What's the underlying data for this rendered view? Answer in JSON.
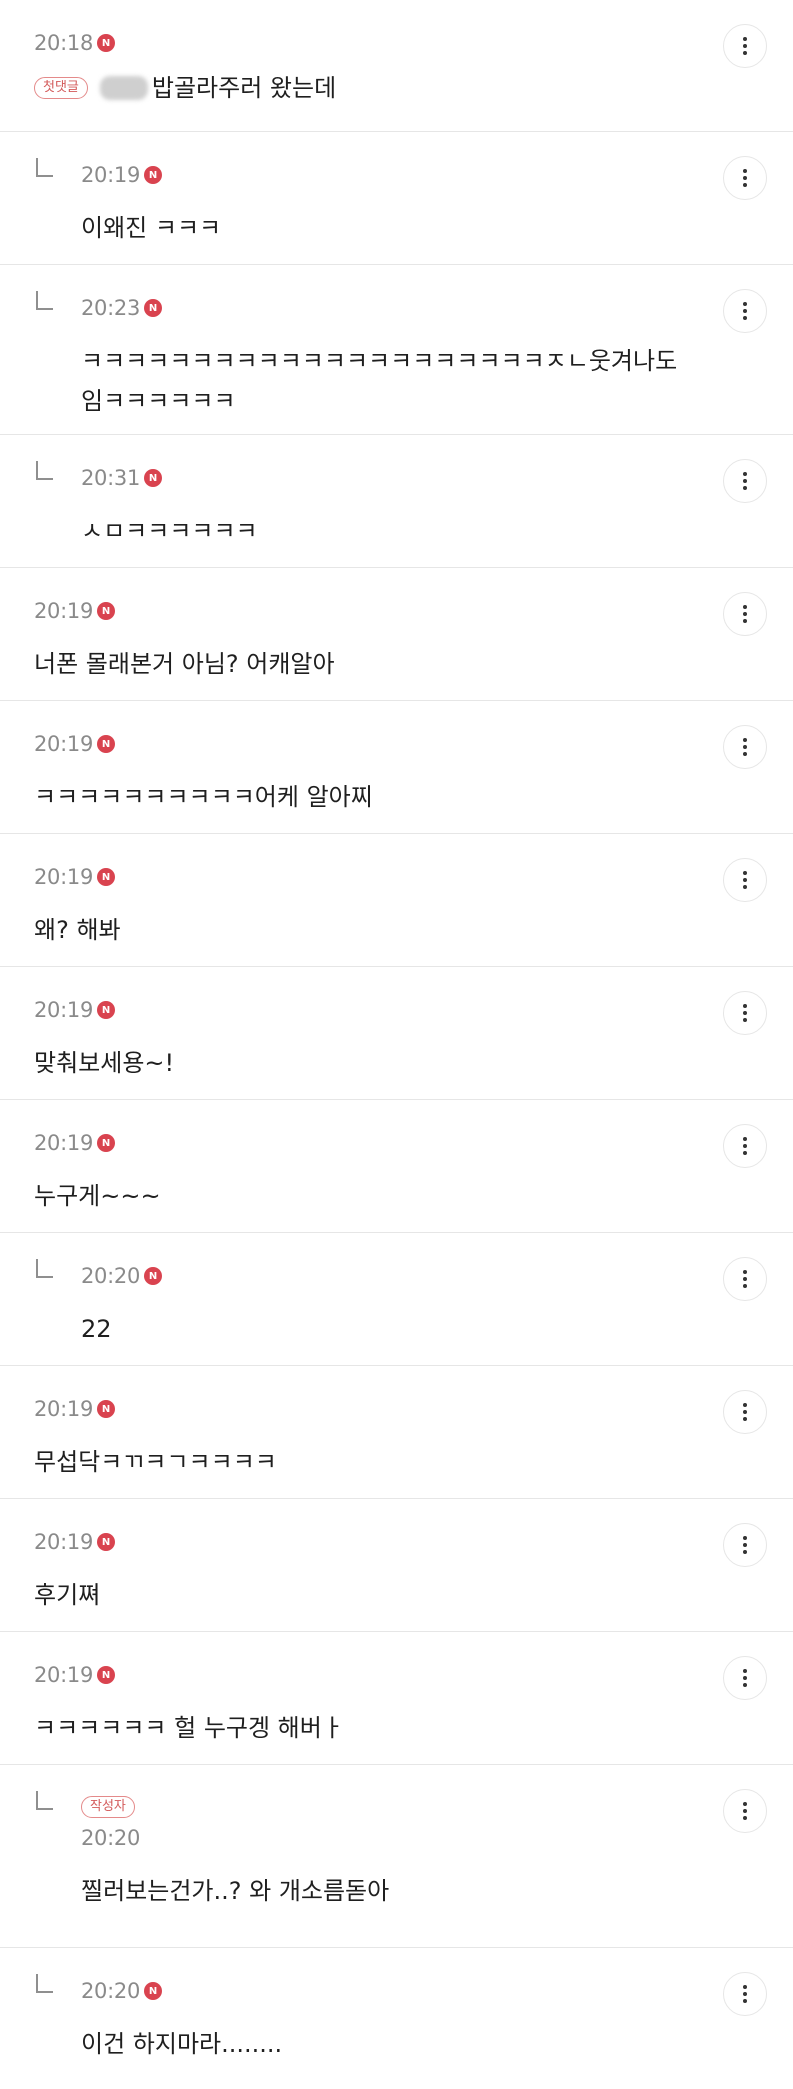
{
  "comments": [
    {
      "time": "20:18",
      "tag": "첫댓글",
      "text": "밥골라주러 왔는데",
      "reply": false,
      "blurred_prefix": true
    },
    {
      "time": "20:19",
      "text": "이왜진 ㅋㅋㅋ",
      "reply": true
    },
    {
      "time": "20:23",
      "text": "ㅋㅋㅋㅋㅋㅋㅋㅋㅋㅋㅋㅋㅋㅋㅋㅋㅋㅋㅋㅋㅋㅈㄴ웃겨나도임ㅋㅋㅋㅋㅋㅋ",
      "reply": true
    },
    {
      "time": "20:31",
      "text": "ㅅㅁㅋㅋㅋㅋㅋㅋ",
      "reply": true
    },
    {
      "time": "20:19",
      "text": "너폰 몰래본거 아님? 어캐알아",
      "reply": false
    },
    {
      "time": "20:19",
      "text": "ㅋㅋㅋㅋㅋㅋㅋㅋㅋㅋ어케 알아찌",
      "reply": false
    },
    {
      "time": "20:19",
      "text": "왜? 해봐",
      "reply": false
    },
    {
      "time": "20:19",
      "text": "맞춰보세용~!",
      "reply": false
    },
    {
      "time": "20:19",
      "text": "누구게~~~",
      "reply": false
    },
    {
      "time": "20:20",
      "text": "22",
      "reply": true
    },
    {
      "time": "20:19",
      "text": "무섭닥ㅋㄲㅋㄱㅋㅋㅋㅋ",
      "reply": false
    },
    {
      "time": "20:19",
      "text": "후기쪄",
      "reply": false
    },
    {
      "time": "20:19",
      "text": "ㅋㅋㅋㅋㅋㅋ 헐 누구겡 해버ㅏ",
      "reply": false
    },
    {
      "time": "20:20",
      "author_tag": "작성자",
      "text": "찔러보는건가..? 와 개소름돋아",
      "reply": true
    },
    {
      "time": "20:20",
      "text": "이건 하지마라........",
      "reply": true
    }
  ],
  "badge_letter": "N",
  "colors": {
    "badge": "#d9434f",
    "tag_border": "#e48a8a",
    "divider": "#e6e6e6",
    "time": "#8a8a8a"
  },
  "icons": {
    "more": "more-vertical-icon",
    "reply_arrow": "reply-arrow-icon"
  }
}
